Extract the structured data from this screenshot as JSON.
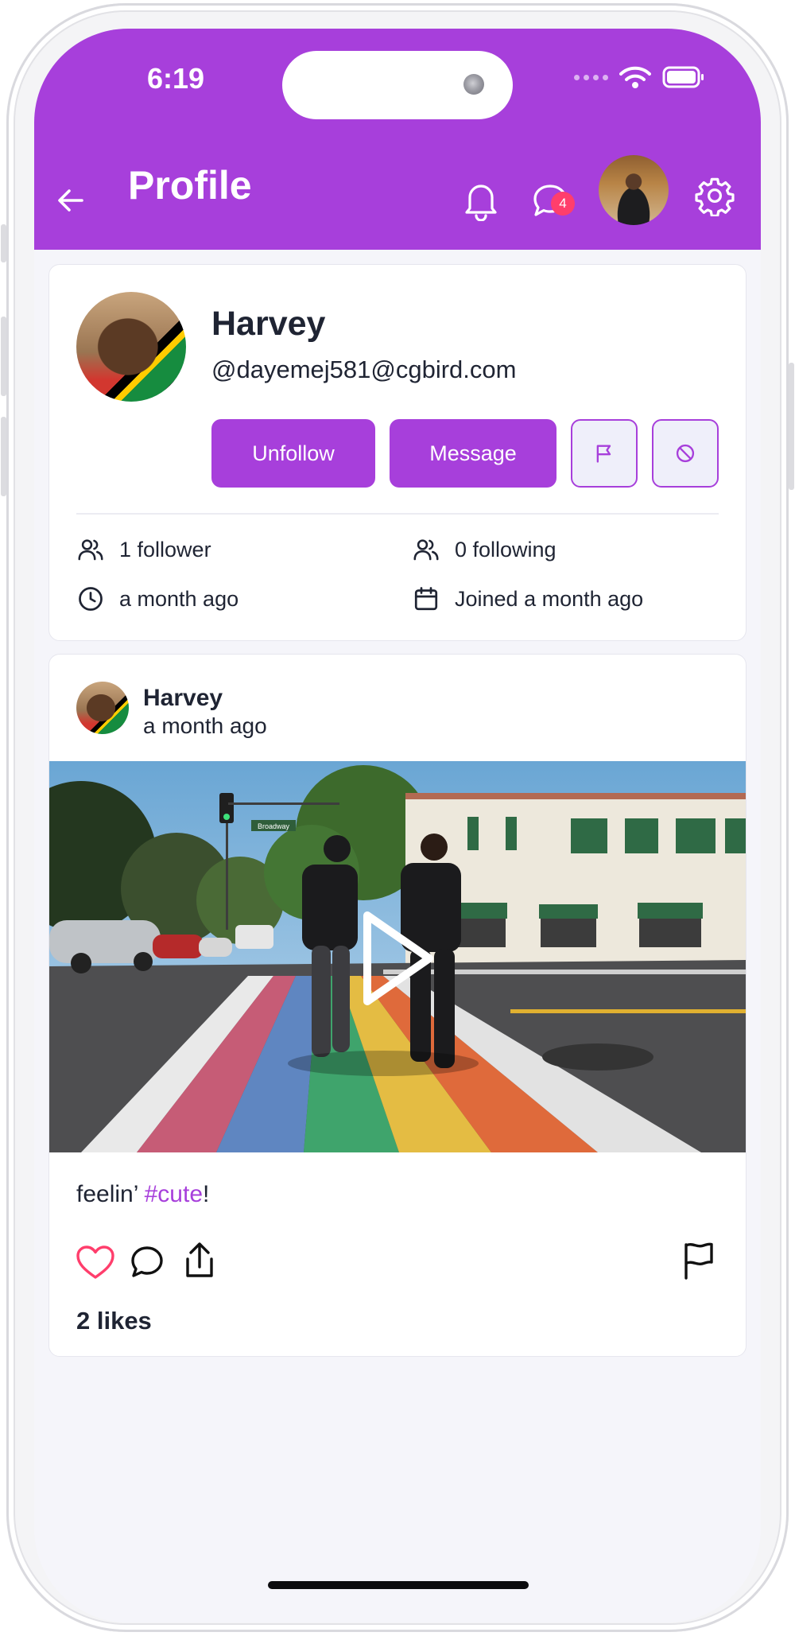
{
  "status_bar": {
    "time": "6:19"
  },
  "header": {
    "title": "Profile",
    "messages_badge": "4"
  },
  "profile": {
    "name": "Harvey",
    "handle": "@dayemej581@cgbird.com",
    "unfollow_label": "Unfollow",
    "message_label": "Message",
    "followers": "1 follower",
    "following": "0 following",
    "last_active": "a month ago",
    "joined": "Joined a month ago"
  },
  "post": {
    "author": "Harvey",
    "time": "a month ago",
    "caption_prefix": "feelin’ ",
    "caption_hashtag": "#cute",
    "caption_suffix": "!",
    "likes": "2 likes",
    "street_sign": "Broadway"
  },
  "colors": {
    "brand": "#a73fdb",
    "badge": "#ff3e6c",
    "like_heart": "#ff3e6c",
    "background": "#f5f5fa"
  },
  "icons": [
    "back-arrow-icon",
    "bell-icon",
    "chat-bubble-icon",
    "gear-icon",
    "flag-icon",
    "block-icon",
    "users-icon",
    "clock-icon",
    "calendar-icon",
    "heart-icon",
    "comment-icon",
    "share-icon",
    "play-icon",
    "wifi-icon",
    "battery-icon"
  ]
}
